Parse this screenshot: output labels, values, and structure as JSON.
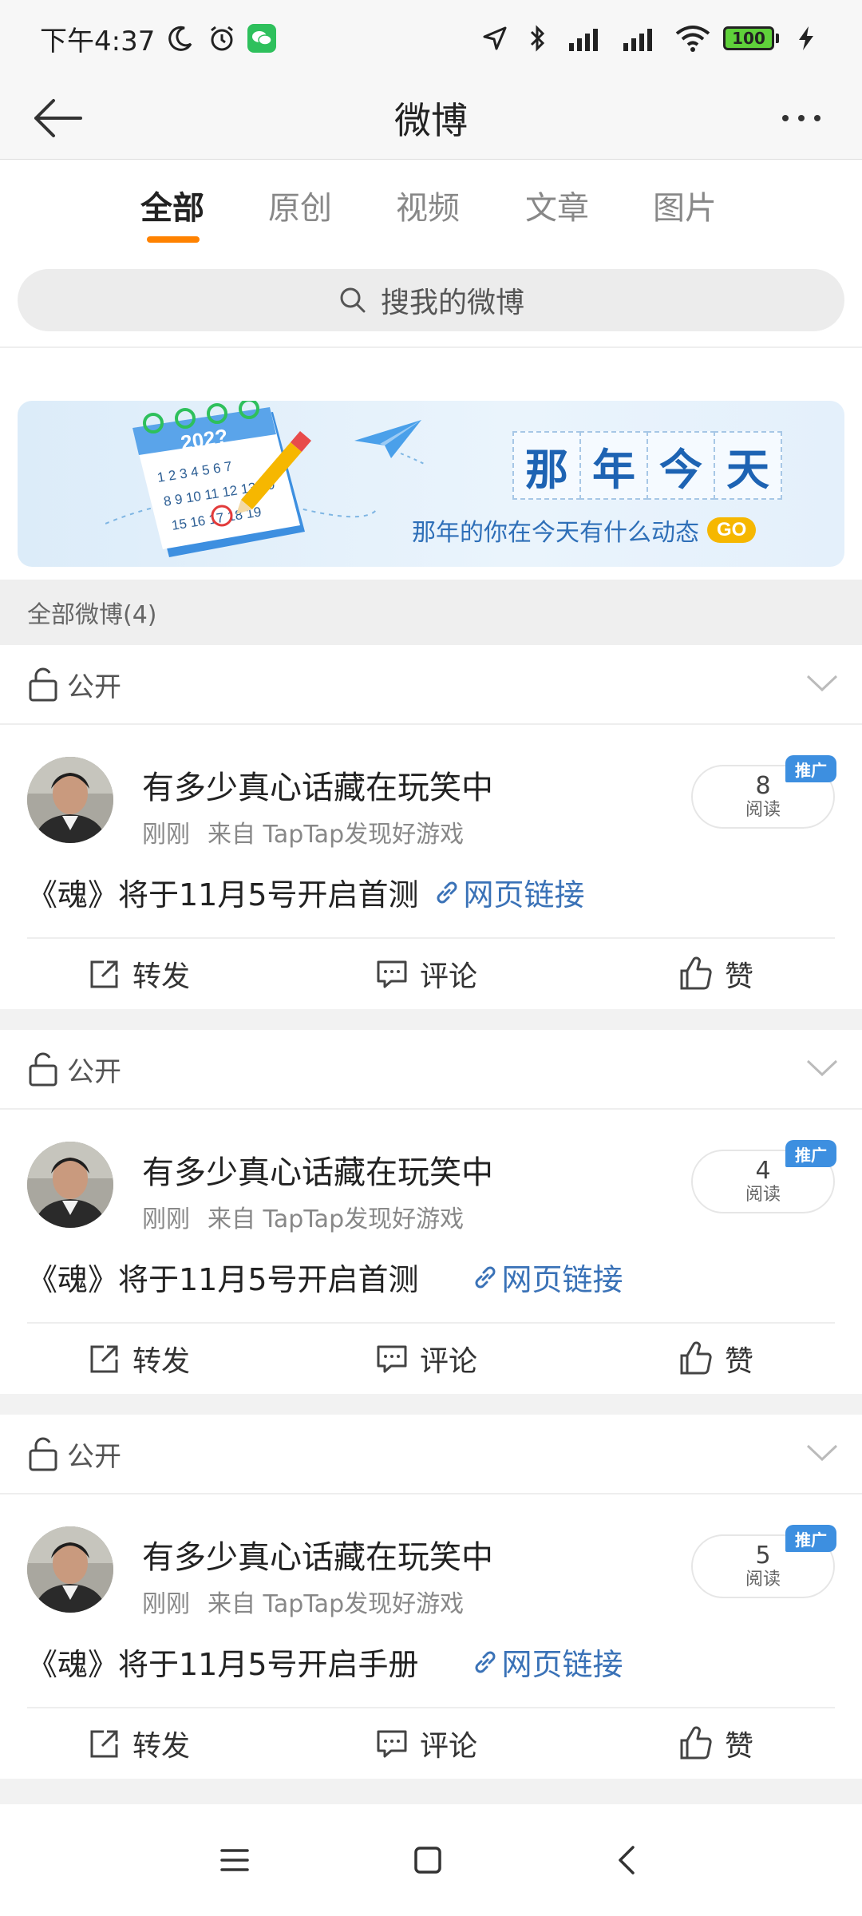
{
  "status_bar": {
    "time": "下午4:37",
    "battery": "100"
  },
  "header": {
    "title": "微博"
  },
  "tabs": [
    {
      "label": "全部"
    },
    {
      "label": "原创"
    },
    {
      "label": "视频"
    },
    {
      "label": "文章"
    },
    {
      "label": "图片"
    }
  ],
  "search": {
    "placeholder": "搜我的微博"
  },
  "banner": {
    "calendar_year": "202?",
    "title_chars": [
      "那",
      "年",
      "今",
      "天"
    ],
    "subtitle": "那年的你在今天有什么动态",
    "go": "GO"
  },
  "section": {
    "title": "全部微博(4)"
  },
  "posts": [
    {
      "visibility": "公开",
      "name": "有多少真心话藏在玩笑中",
      "time": "刚刚",
      "source": "来自 TapTap发现好游戏",
      "reads": "8",
      "reads_label": "阅读",
      "badge": "推广",
      "text": "《魂》将于11月5号开启首测",
      "link": "网页链接",
      "actions": {
        "repost": "转发",
        "comment": "评论",
        "like": "赞"
      }
    },
    {
      "visibility": "公开",
      "name": "有多少真心话藏在玩笑中",
      "time": "刚刚",
      "source": "来自 TapTap发现好游戏",
      "reads": "4",
      "reads_label": "阅读",
      "badge": "推广",
      "text": "《魂》将于11月5号开启首测",
      "link": "网页链接",
      "actions": {
        "repost": "转发",
        "comment": "评论",
        "like": "赞"
      }
    },
    {
      "visibility": "公开",
      "name": "有多少真心话藏在玩笑中",
      "time": "刚刚",
      "source": "来自 TapTap发现好游戏",
      "reads": "5",
      "reads_label": "阅读",
      "badge": "推广",
      "text": "《魂》将于11月5号开启手册",
      "link": "网页链接",
      "actions": {
        "repost": "转发",
        "comment": "评论",
        "like": "赞"
      }
    }
  ],
  "colors": {
    "accent": "#ff8200",
    "link": "#3a72b7",
    "badge": "#3d8fe0"
  },
  "icons": [
    "moon-icon",
    "alarm-icon",
    "wechat-icon",
    "location-icon",
    "bluetooth-icon",
    "signal-icon",
    "wifi-icon",
    "battery-icon",
    "charging-icon",
    "back-arrow-icon",
    "more-icon",
    "search-icon",
    "lock-icon",
    "chevron-down-icon",
    "link-icon",
    "repost-icon",
    "comment-icon",
    "like-icon",
    "menu-icon",
    "home-icon",
    "back-icon"
  ]
}
